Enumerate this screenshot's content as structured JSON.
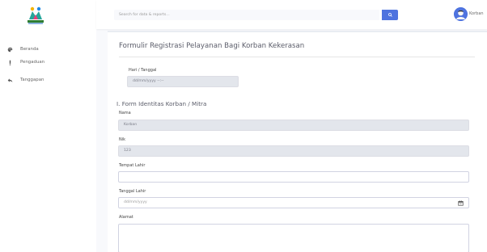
{
  "sidebar": {
    "items": [
      {
        "label": "Beranda",
        "icon": "palette-icon"
      },
      {
        "label": "Pengaduan",
        "icon": "exclamation-icon"
      },
      {
        "label": "Tanggapan",
        "icon": "reply-icon"
      }
    ]
  },
  "topbar": {
    "search_placeholder": "Search for data & reports...",
    "user_name": "Korban"
  },
  "form": {
    "title": "Formulir Registrasi Pelayanan Bagi Korban Kekerasan",
    "hari_tanggal_label": "Hari / Tanggal",
    "hari_tanggal_value": "dd/mm/yyyy --:--",
    "section_title": "I. Form Identitas Korban / Mitra",
    "nama_label": "Nama",
    "nama_value": "Korban",
    "nik_label": "Nik",
    "nik_value": "123",
    "tempat_lahir_label": "Tempat Lahir",
    "tempat_lahir_value": "",
    "tanggal_lahir_label": "Tanggal Lahir",
    "tanggal_lahir_value": "dd/mm/yyyy",
    "alamat_label": "Alamat",
    "alamat_value": ""
  },
  "colors": {
    "primary": "#4e73df",
    "background": "#f8f9fc",
    "disabled_input": "#e3e6ec"
  }
}
